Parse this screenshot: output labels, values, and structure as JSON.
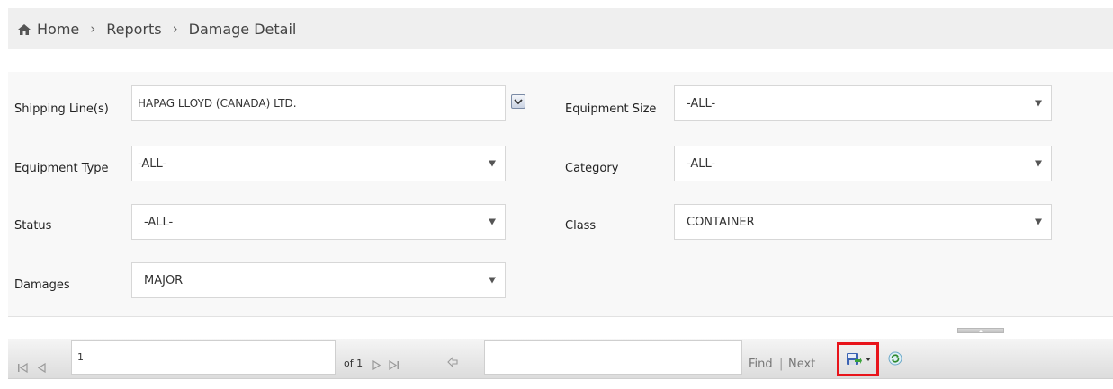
{
  "breadcrumb": {
    "home": "Home",
    "reports": "Reports",
    "current": "Damage Detail",
    "separator": "›"
  },
  "form": {
    "shipping_line": {
      "label": "Shipping Line(s)",
      "value": "HAPAG LLOYD (CANADA) LTD."
    },
    "equipment_size": {
      "label": "Equipment Size",
      "value": "-ALL-"
    },
    "equipment_type": {
      "label": "Equipment Type",
      "value": "-ALL-"
    },
    "category": {
      "label": "Category",
      "value": "-ALL-"
    },
    "status": {
      "label": "Status",
      "value": "-ALL-"
    },
    "class": {
      "label": "Class",
      "value": "CONTAINER"
    },
    "damages": {
      "label": "Damages",
      "value": "MAJOR"
    }
  },
  "toolbar": {
    "page_number": "1",
    "of_text": "of 1",
    "find_label": "Find",
    "pipe": "|",
    "next_label": "Next"
  },
  "colors": {
    "highlight": "#e8141b",
    "panel_bg": "#f8f8f8",
    "breadcrumb_bg": "#efefef"
  }
}
